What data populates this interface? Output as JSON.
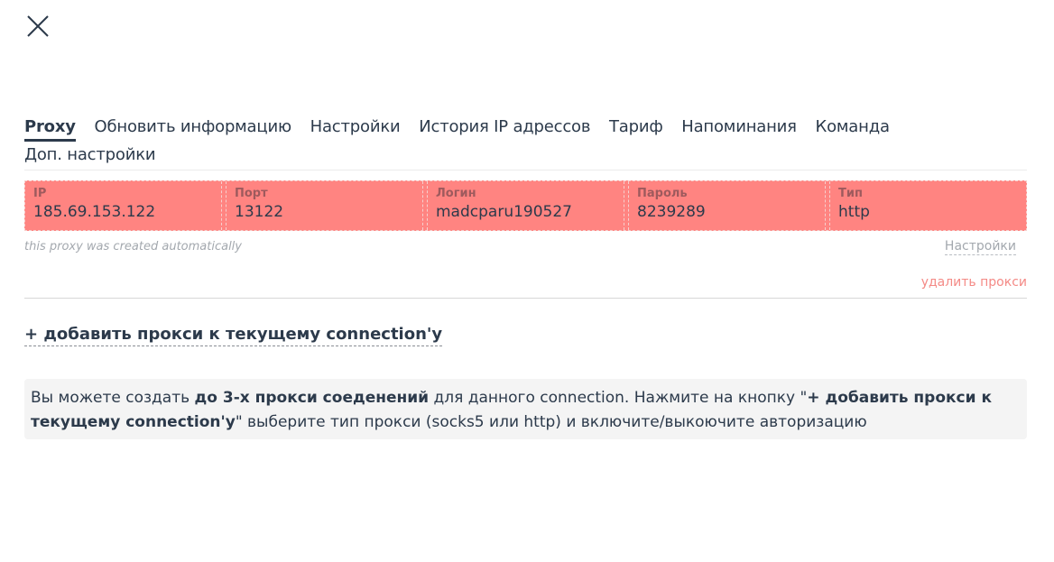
{
  "close_button": {
    "icon": "close-icon"
  },
  "tabs": [
    {
      "label": "Proxy",
      "active": true
    },
    {
      "label": "Обновить информацию",
      "active": false
    },
    {
      "label": "Настройки",
      "active": false
    },
    {
      "label": "История IP адрессов",
      "active": false
    },
    {
      "label": "Тариф",
      "active": false
    },
    {
      "label": "Напоминания",
      "active": false
    },
    {
      "label": "Команда",
      "active": false
    },
    {
      "label": "Доп. настройки",
      "active": false
    }
  ],
  "proxy": {
    "colors": {
      "background": "#ff8481",
      "delete_link": "#f48a86"
    },
    "fields": [
      {
        "label": "IP",
        "value": "185.69.153.122"
      },
      {
        "label": "Порт",
        "value": "13122"
      },
      {
        "label": "Логин",
        "value": "madcparu190527"
      },
      {
        "label": "Пароль",
        "value": "8239289"
      },
      {
        "label": "Тип",
        "value": "http"
      }
    ],
    "note": "this proxy was created automatically",
    "settings_label": "Настройки",
    "delete_label": "удалить прокси"
  },
  "add_proxy_label": "+ добавить прокси к текущему connection'у",
  "info": {
    "part1": "Вы можете создать ",
    "bold1": "до 3-х прокси соеденений",
    "part2": " для данного connection. Нажмите на кнопку \"",
    "bold2": "+ добавить прокси к текущему connection'у",
    "part3": "\" выберите тип прокси (socks5 или http) и включите/выкоючите авторизацию"
  }
}
